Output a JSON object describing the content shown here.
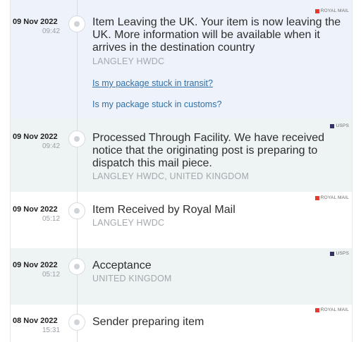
{
  "events": [
    {
      "date": "09 Nov 2022",
      "time": "09:42",
      "description": "Item Leaving the UK. Your item is now leaving the UK. More information will be available when it arrives in the destination country",
      "location": "LANGLEY HWDC",
      "carrier": "ROYAL MAIL",
      "carrier_color": "#e03c31",
      "links": [
        "Is my package stuck in transit?",
        "Is my package stuck in customs?"
      ]
    },
    {
      "date": "09 Nov 2022",
      "time": "09:42",
      "description": "Processed Through Facility. We have received notice that the originating post is preparing to dispatch this mail piece.",
      "location": "LANGLEY HWDC, UNITED KINGDOM",
      "carrier": "USPS",
      "carrier_color": "#333366"
    },
    {
      "date": "09 Nov 2022",
      "time": "05:12",
      "description": "Item Received by Royal Mail",
      "location": "LANGLEY HWDC",
      "carrier": "ROYAL MAIL",
      "carrier_color": "#e03c31"
    },
    {
      "date": "09 Nov 2022",
      "time": "05:12",
      "description": "Acceptance",
      "location": "UNITED KINGDOM",
      "carrier": "USPS",
      "carrier_color": "#333366"
    },
    {
      "date": "08 Nov 2022",
      "time": "15:31",
      "description": "Sender preparing item",
      "carrier": "ROYAL MAIL",
      "carrier_color": "#e03c31"
    }
  ]
}
